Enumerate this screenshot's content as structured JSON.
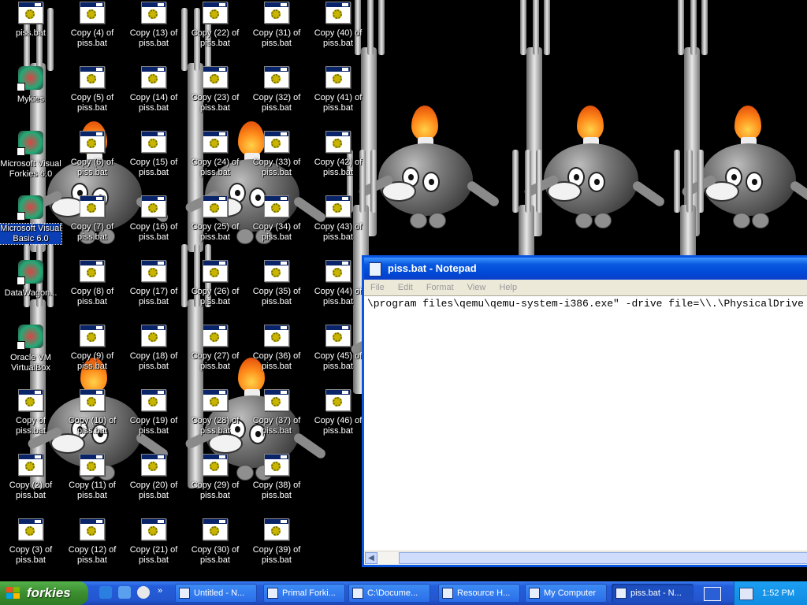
{
  "desktop": {
    "icons": [
      {
        "label": "piss.bat",
        "type": "bat"
      },
      {
        "label": "Mykies",
        "type": "app"
      },
      {
        "label": "Microsoft Visual Forkies 6.0",
        "type": "app"
      },
      {
        "label": "Microsoft Visual Basic 6.0",
        "type": "app",
        "selected": true
      },
      {
        "label": "DataWagon...",
        "type": "app"
      },
      {
        "label": "Oracle VM VirtualBox",
        "type": "app"
      },
      {
        "label": "Copy of piss.bat",
        "type": "bat"
      },
      {
        "label": "Copy (2) of piss.bat",
        "type": "bat"
      },
      {
        "label": "Copy (3) of piss.bat",
        "type": "bat"
      },
      {
        "label": "Copy (4) of piss.bat",
        "type": "bat"
      },
      {
        "label": "Copy (5) of piss.bat",
        "type": "bat"
      },
      {
        "label": "Copy (6) of piss.bat",
        "type": "bat"
      },
      {
        "label": "Copy (7) of piss.bat",
        "type": "bat"
      },
      {
        "label": "Copy (8) of piss.bat",
        "type": "bat"
      },
      {
        "label": "Copy (9) of piss.bat",
        "type": "bat"
      },
      {
        "label": "Copy (10) of piss.bat",
        "type": "bat"
      },
      {
        "label": "Copy (11) of piss.bat",
        "type": "bat"
      },
      {
        "label": "Copy (12) of piss.bat",
        "type": "bat"
      },
      {
        "label": "Copy (13) of piss.bat",
        "type": "bat"
      },
      {
        "label": "Copy (14) of piss.bat",
        "type": "bat"
      },
      {
        "label": "Copy (15) of piss.bat",
        "type": "bat"
      },
      {
        "label": "Copy (16) of piss.bat",
        "type": "bat"
      },
      {
        "label": "Copy (17) of piss.bat",
        "type": "bat"
      },
      {
        "label": "Copy (18) of piss.bat",
        "type": "bat"
      },
      {
        "label": "Copy (19) of piss.bat",
        "type": "bat"
      },
      {
        "label": "Copy (20) of piss.bat",
        "type": "bat"
      },
      {
        "label": "Copy (21) of piss.bat",
        "type": "bat"
      },
      {
        "label": "Copy (22) of piss.bat",
        "type": "bat"
      },
      {
        "label": "Copy (23) of piss.bat",
        "type": "bat"
      },
      {
        "label": "Copy (24) of piss.bat",
        "type": "bat"
      },
      {
        "label": "Copy (25) of piss.bat",
        "type": "bat"
      },
      {
        "label": "Copy (26) of piss.bat",
        "type": "bat"
      },
      {
        "label": "Copy (27) of piss.bat",
        "type": "bat"
      },
      {
        "label": "Copy (28) of piss.bat",
        "type": "bat"
      },
      {
        "label": "Copy (29) of piss.bat",
        "type": "bat"
      },
      {
        "label": "Copy (30) of piss.bat",
        "type": "bat"
      },
      {
        "label": "Copy (31) of piss.bat",
        "type": "bat"
      },
      {
        "label": "Copy (32) of piss.bat",
        "type": "bat"
      },
      {
        "label": "Copy (33) of piss.bat",
        "type": "bat"
      },
      {
        "label": "Copy (34) of piss.bat",
        "type": "bat"
      },
      {
        "label": "Copy (35) of piss.bat",
        "type": "bat"
      },
      {
        "label": "Copy (36) of piss.bat",
        "type": "bat"
      },
      {
        "label": "Copy (37) of piss.bat",
        "type": "bat"
      },
      {
        "label": "Copy (38) of piss.bat",
        "type": "bat"
      },
      {
        "label": "Copy (39) of piss.bat",
        "type": "bat"
      },
      {
        "label": "Copy (40) of piss.bat",
        "type": "bat"
      },
      {
        "label": "Copy (41) of piss.bat",
        "type": "bat"
      },
      {
        "label": "Copy (42) of piss.bat",
        "type": "bat"
      },
      {
        "label": "Copy (43) of piss.bat",
        "type": "bat"
      },
      {
        "label": "Copy (44) of piss.bat",
        "type": "bat"
      },
      {
        "label": "Copy (45) of piss.bat",
        "type": "bat"
      },
      {
        "label": "Copy (46) of piss.bat",
        "type": "bat"
      }
    ]
  },
  "notepad": {
    "title": "piss.bat - Notepad",
    "menu": [
      "File",
      "Edit",
      "Format",
      "View",
      "Help"
    ],
    "content": "\\program files\\qemu\\qemu-system-i386.exe\" -drive file=\\\\.\\PhysicalDrive"
  },
  "taskbar": {
    "start_label": "forkies",
    "quick_launch": [
      "ie-icon",
      "show-desktop-icon",
      "media-player-icon"
    ],
    "tasks": [
      {
        "label": "Untitled - N...",
        "icon": "paint-icon"
      },
      {
        "label": "Primal Forki...",
        "icon": "forkie-icon"
      },
      {
        "label": "C:\\Docume...",
        "icon": "cmd-icon"
      },
      {
        "label": "Resource H...",
        "icon": "resource-hacker-icon"
      },
      {
        "label": "My Computer",
        "icon": "folder-icon"
      },
      {
        "label": "piss.bat - N...",
        "icon": "notepad-icon",
        "active": true
      }
    ],
    "clock": "1:52 PM"
  },
  "colors": {
    "title_bar": "#0a5ae0",
    "taskbar": "#245edb",
    "start": "#3c8d2f",
    "tray": "#0f8ce2",
    "selection": "#0b3fb5"
  }
}
